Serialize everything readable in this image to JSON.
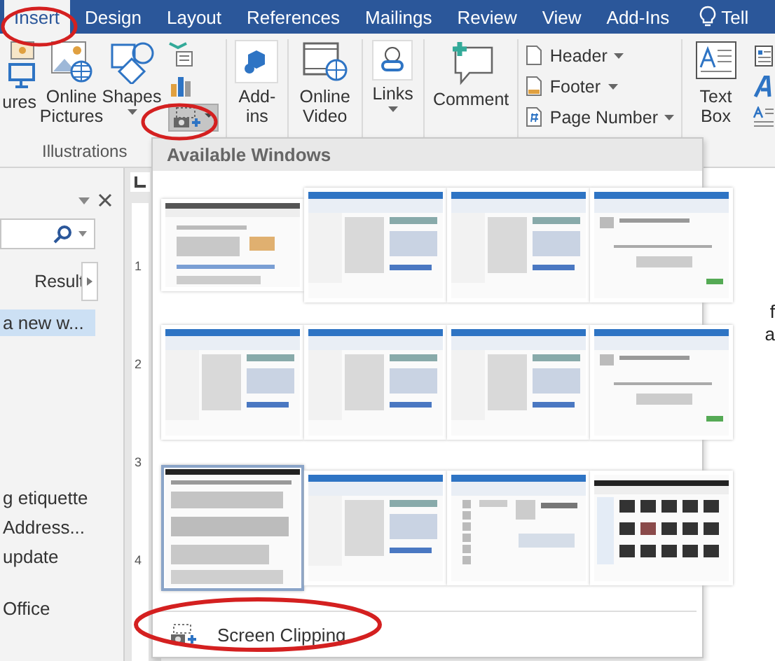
{
  "tabs": [
    {
      "label": "Insert",
      "selected": true
    },
    {
      "label": "Design",
      "selected": false
    },
    {
      "label": "Layout",
      "selected": false
    },
    {
      "label": "References",
      "selected": false
    },
    {
      "label": "Mailings",
      "selected": false
    },
    {
      "label": "Review",
      "selected": false
    },
    {
      "label": "View",
      "selected": false
    },
    {
      "label": "Add-Ins",
      "selected": false
    }
  ],
  "tell_me": {
    "label": "Tell"
  },
  "ribbon": {
    "pictures": "ures",
    "online_pictures": "Online Pictures",
    "shapes": "Shapes",
    "screenshot": {
      "pressed": true
    },
    "group_label": "Illustrations",
    "add_ins": "Add-ins",
    "online_video": "Online Video",
    "links": "Links",
    "comment": "Comment",
    "header": "Header",
    "footer": "Footer",
    "page_number": "Page Number",
    "text_box": "Text Box"
  },
  "nav_pane": {
    "results_label": "Result",
    "items": [
      {
        "text": "a new w...",
        "selected": true
      },
      {
        "text": "g etiquette",
        "selected": false
      },
      {
        "text": "Address...",
        "selected": false
      },
      {
        "text": "update",
        "selected": false
      },
      {
        "text": "Office",
        "selected": false
      }
    ]
  },
  "ruler": {
    "labels": [
      "1",
      "2",
      "3",
      "4"
    ]
  },
  "document_fragments": [
    "f",
    "a"
  ],
  "screenshot_menu": {
    "heading": "Available Windows",
    "windows": [
      {
        "kind": "browser",
        "selected": false
      },
      {
        "kind": "mail",
        "selected": false
      },
      {
        "kind": "mail",
        "selected": false
      },
      {
        "kind": "message",
        "selected": false
      },
      {
        "kind": "mail",
        "selected": false
      },
      {
        "kind": "mail",
        "selected": false
      },
      {
        "kind": "mail",
        "selected": false
      },
      {
        "kind": "message",
        "selected": false
      },
      {
        "kind": "document",
        "selected": true
      },
      {
        "kind": "mail",
        "selected": false
      },
      {
        "kind": "contacts",
        "selected": false
      },
      {
        "kind": "explorer",
        "selected": false
      }
    ],
    "clipping": "Screen Clipping"
  }
}
